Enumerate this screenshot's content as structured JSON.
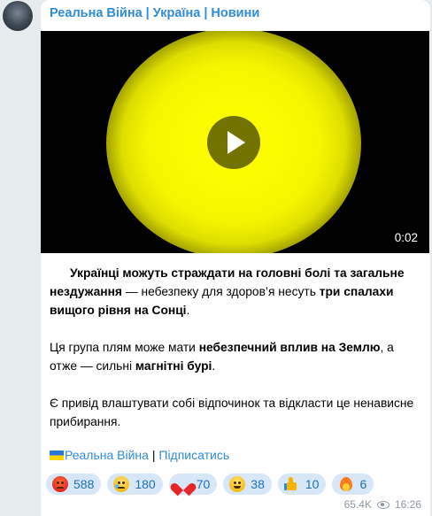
{
  "channel": {
    "title": "Реальна Війна | Україна | Новини"
  },
  "video": {
    "duration": "0:02"
  },
  "post": {
    "p1_a": "Українці можуть страждати на головні болі та загальне нездужання",
    "p1_b": " — небезпеку для здоров’я несуть ",
    "p1_c": "три спалахи вищого рівня на Сонці",
    "p1_d": ".",
    "p2_a": "Ця група плям може мати ",
    "p2_b": "небезпечний вплив на Землю",
    "p2_c": ", а отже — сильні ",
    "p2_d": "магнітні бурі",
    "p2_e": ".",
    "p3": "Є привід влаштувати собі відпочинок та відкласти це ненависне прибирання."
  },
  "footer": {
    "channel_link": "Реальна Війна",
    "separator": " | ",
    "subscribe_link": "Підписатись"
  },
  "reactions": [
    {
      "emoji": "angry-face",
      "count": "588"
    },
    {
      "emoji": "crying-face",
      "count": "180"
    },
    {
      "emoji": "red-heart",
      "count": "70"
    },
    {
      "emoji": "grinning-face",
      "count": "38"
    },
    {
      "emoji": "thumbs-up",
      "count": "10"
    },
    {
      "emoji": "fire",
      "count": "6"
    }
  ],
  "meta": {
    "views": "65.4K",
    "time": "16:26"
  }
}
